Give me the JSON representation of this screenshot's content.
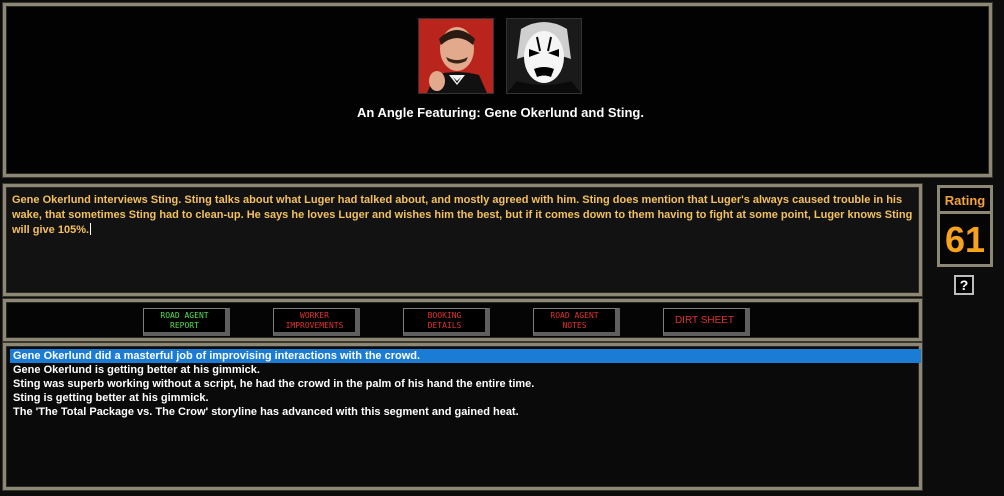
{
  "angle": {
    "title": "An Angle Featuring: Gene Okerlund and Sting.",
    "portraits": [
      "Gene Okerlund",
      "Sting"
    ]
  },
  "description": "Gene Okerlund interviews Sting. Sting talks about what Luger had talked about, and mostly agreed with him. Sting does mention that Luger's always caused trouble in his wake, that sometimes Sting had to clean-up. He says he loves Luger and wishes him the best, but if it comes down to them having to fight at some point, Luger knows Sting will give 105%.",
  "rating": {
    "label": "Rating",
    "value": "61"
  },
  "help": {
    "label": "?"
  },
  "buttons": {
    "road_agent_report": "ROAD AGENT\nREPORT",
    "worker_improvements": "WORKER\nIMPROVEMENTS",
    "booking_details": "BOOKING\nDETAILS",
    "road_agent_notes": "ROAD AGENT\nNOTES",
    "dirt_sheet": "DIRT SHEET"
  },
  "log": [
    "Gene Okerlund did a masterful job of improvising interactions with the crowd.",
    "Gene Okerlund is getting better at his gimmick.",
    "Sting was superb working without a script, he had the crowd in the palm of his hand the entire time.",
    "Sting is getting better at his gimmick.",
    "The 'The Total Package vs. The Crow' storyline has advanced with this segment and gained heat."
  ],
  "colors": {
    "description_text": "#f4c15c",
    "rating_value": "#f7a21c",
    "selection": "#1b7cd6",
    "active_button": "#52e04c",
    "inactive_button": "#e0322c",
    "frame": "#8d8775"
  }
}
